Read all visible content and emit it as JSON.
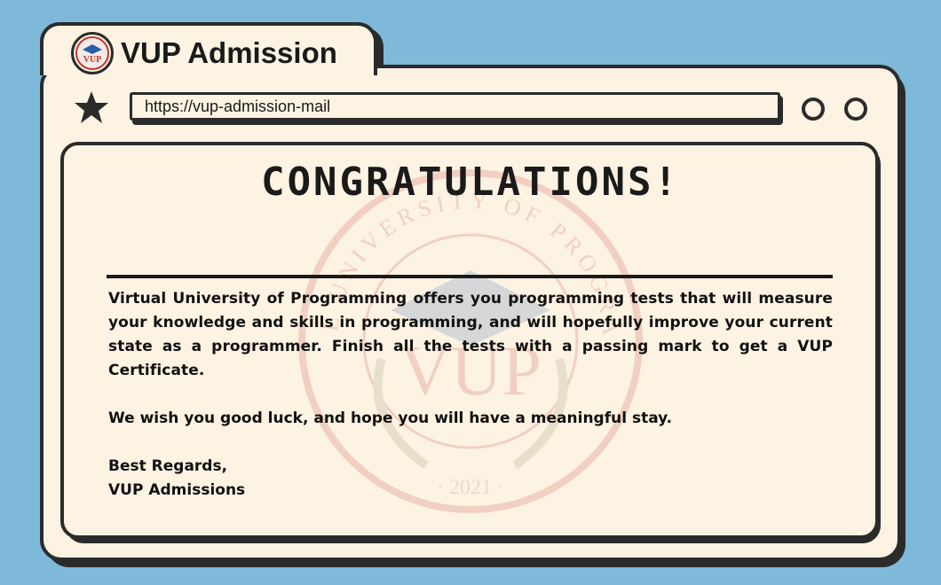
{
  "app": {
    "title": "VUP Admission",
    "url": "https://vup-admission-mail"
  },
  "logo": {
    "text": "VUP"
  },
  "watermark": {
    "ring_text": "VIRTUAL UNIVERSITY OF PROGRAMMING",
    "initials": "VUP",
    "year": "· 2021 ·"
  },
  "message": {
    "heading": "CONGRATULATIONS!",
    "paragraph1": "Virtual University of Programming offers you programming tests that will measure your knowledge and skills in programming, and will hopefully improve your current state as a programmer. Finish all the tests with a passing mark to get a VUP Certificate.",
    "paragraph2": "We wish you good luck, and hope you will have a meaningful stay.",
    "closing_line1": "Best Regards,",
    "closing_line2": "VUP Admissions"
  },
  "colors": {
    "background": "#7fb9d9",
    "paper": "#fdf3e3",
    "ink": "#2b2b2b",
    "logo_red": "#c0392b",
    "logo_blue": "#2a5ca8"
  }
}
